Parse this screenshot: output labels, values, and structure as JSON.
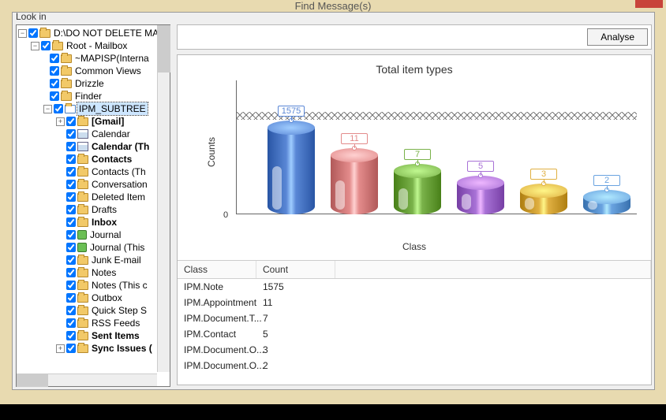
{
  "window": {
    "title": "Find Message(s)",
    "look_in_label": "Look in"
  },
  "toolbar": {
    "analyse_label": "Analyse"
  },
  "tree": {
    "root_label": "D:\\DO NOT DELETE MAI",
    "mailbox_label": "Root - Mailbox",
    "items": [
      {
        "label": "~MAPISP(Interna",
        "bold": false
      },
      {
        "label": "Common Views",
        "bold": false
      },
      {
        "label": "Drizzle",
        "bold": false
      },
      {
        "label": "Finder",
        "bold": false
      }
    ],
    "subtree_label": "IPM_SUBTREE",
    "subtree_items": [
      {
        "label": "[Gmail]",
        "exp": "+",
        "bold": true,
        "icon": "folder"
      },
      {
        "label": "Calendar",
        "exp": "none",
        "bold": false,
        "icon": "cal"
      },
      {
        "label": "Calendar (Th",
        "exp": "none",
        "bold": true,
        "icon": "cal"
      },
      {
        "label": "Contacts",
        "exp": "none",
        "bold": true,
        "icon": "folder"
      },
      {
        "label": "Contacts (Th",
        "exp": "none",
        "bold": false,
        "icon": "folder"
      },
      {
        "label": "Conversation",
        "exp": "none",
        "bold": false,
        "icon": "folder"
      },
      {
        "label": "Deleted Item",
        "exp": "none",
        "bold": false,
        "icon": "folder"
      },
      {
        "label": "Drafts",
        "exp": "none",
        "bold": false,
        "icon": "folder"
      },
      {
        "label": "Inbox",
        "exp": "none",
        "bold": true,
        "icon": "folder"
      },
      {
        "label": "Journal",
        "exp": "none",
        "bold": false,
        "icon": "jrn"
      },
      {
        "label": "Journal (This",
        "exp": "none",
        "bold": false,
        "icon": "jrn"
      },
      {
        "label": "Junk E-mail",
        "exp": "none",
        "bold": false,
        "icon": "folder"
      },
      {
        "label": "Notes",
        "exp": "none",
        "bold": false,
        "icon": "folder"
      },
      {
        "label": "Notes (This c",
        "exp": "none",
        "bold": false,
        "icon": "folder"
      },
      {
        "label": "Outbox",
        "exp": "none",
        "bold": false,
        "icon": "folder"
      },
      {
        "label": "Quick Step S",
        "exp": "none",
        "bold": false,
        "icon": "folder"
      },
      {
        "label": "RSS Feeds",
        "exp": "none",
        "bold": false,
        "icon": "folder"
      },
      {
        "label": "Sent Items",
        "exp": "none",
        "bold": true,
        "icon": "folder"
      },
      {
        "label": "Sync Issues (",
        "exp": "+",
        "bold": true,
        "icon": "folder"
      }
    ]
  },
  "chart_data": {
    "type": "bar",
    "title": "Total item types",
    "xlabel": "Class",
    "ylabel": "Counts",
    "categories": [
      "IPM.Note",
      "IPM.Appointment",
      "IPM.Document.T...",
      "IPM.Contact",
      "IPM.Document.O...",
      "IPM.Document.O..."
    ],
    "values": [
      1575,
      11,
      7,
      5,
      3,
      2
    ],
    "bar_colors": [
      "#5a87d6",
      "#e38b8b",
      "#7ab24a",
      "#a871d6",
      "#e0b042",
      "#6aa3e0"
    ],
    "ylim": [
      0,
      1600
    ],
    "axis_break": true
  },
  "table": {
    "headers": {
      "class": "Class",
      "count": "Count"
    },
    "rows": [
      {
        "class": "IPM.Note",
        "count": "1575"
      },
      {
        "class": "IPM.Appointment",
        "count": "11"
      },
      {
        "class": "IPM.Document.T...",
        "count": "7"
      },
      {
        "class": "IPM.Contact",
        "count": "5"
      },
      {
        "class": "IPM.Document.O...",
        "count": "3"
      },
      {
        "class": "IPM.Document.O...",
        "count": "2"
      }
    ]
  }
}
